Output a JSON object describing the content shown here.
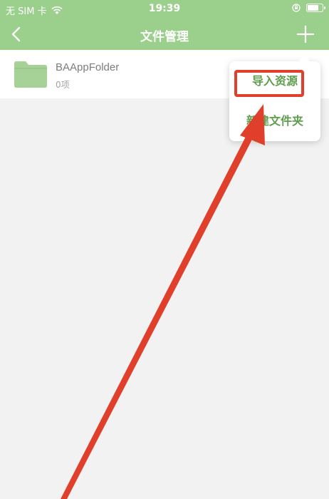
{
  "status_bar": {
    "carrier": "无 SIM 卡",
    "time": "19:39",
    "icons": [
      "wifi-icon",
      "orientation-lock-icon",
      "battery-icon"
    ]
  },
  "nav": {
    "title": "文件管理",
    "back_icon": "chevron-left-icon",
    "add_icon": "plus-icon"
  },
  "files": [
    {
      "name": "BAAppFolder",
      "count": "0项",
      "icon": "folder-icon"
    }
  ],
  "popup_menu": {
    "items": [
      {
        "label": "导入资源"
      },
      {
        "label": "新建文件夹"
      }
    ]
  },
  "colors": {
    "header_green": "#9bcf8c",
    "menu_green": "#5f9e4e",
    "folder_green": "#a6d197",
    "annotation_red": "#e0402b",
    "background": "#f2f2f2"
  }
}
